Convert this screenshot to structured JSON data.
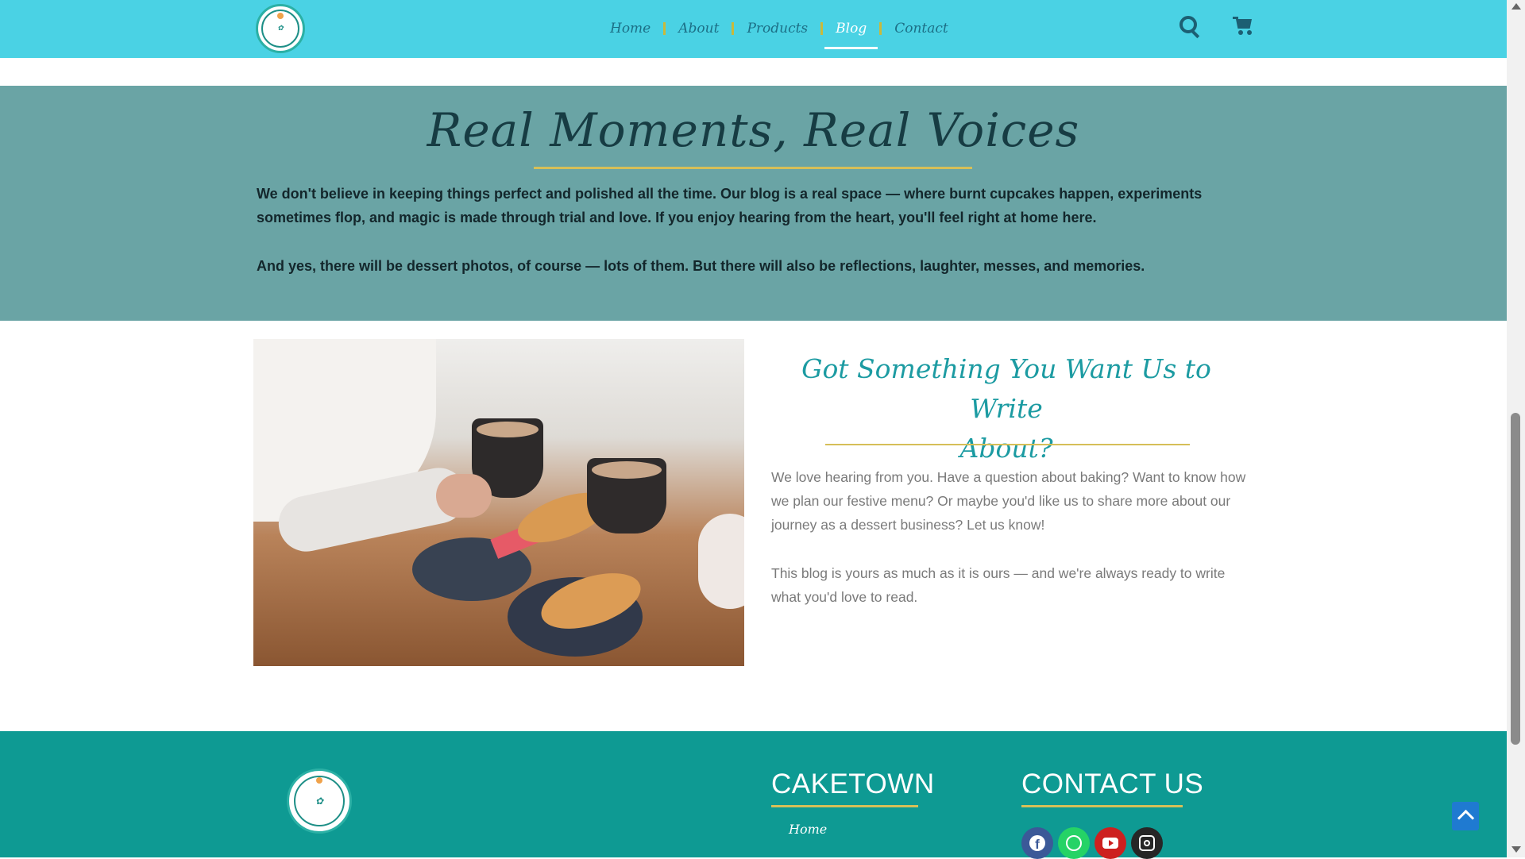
{
  "header": {
    "nav": [
      {
        "label": "Home"
      },
      {
        "label": "About"
      },
      {
        "label": "Products"
      },
      {
        "label": "Blog",
        "active": true
      },
      {
        "label": "Contact"
      }
    ],
    "icons": [
      "search-icon",
      "cart-icon"
    ]
  },
  "intro": {
    "title": "Real Moments, Real Voices",
    "paragraph1": "We don't believe in keeping things perfect and polished all the time. Our blog is a real space — where burnt cupcakes happen, experiments sometimes flop, and magic is made through trial and love. If you enjoy hearing from the heart, you'll feel right at home here.",
    "paragraph2": "And yes, there will be dessert photos, of course — lots of them. But there will also be reflections, laughter, messes, and memories."
  },
  "feature": {
    "title_line1": "Got Something You Want Us to Write",
    "title_line2": "About?",
    "paragraph1": "We love hearing from you. Have a question about baking? Want to know how we plan our festive menu? Or maybe you'd like us to share more about our journey as a dessert business? Let us know!",
    "paragraph2": "This blog is yours as much as it is ours — and we're always ready to write what you'd love to read."
  },
  "footer": {
    "col1_heading": "CAKETOWN",
    "col1_links": [
      "Home"
    ],
    "col2_heading": "CONTACT US",
    "social": [
      "facebook-icon",
      "whatsapp-icon",
      "youtube-icon",
      "instagram-icon"
    ]
  },
  "colors": {
    "header": "#4ad2e4",
    "band": "#6aa4a5",
    "footer": "#0e9a93",
    "accent_gold": "#d6bf58",
    "feature_title": "#1c9ba2"
  }
}
